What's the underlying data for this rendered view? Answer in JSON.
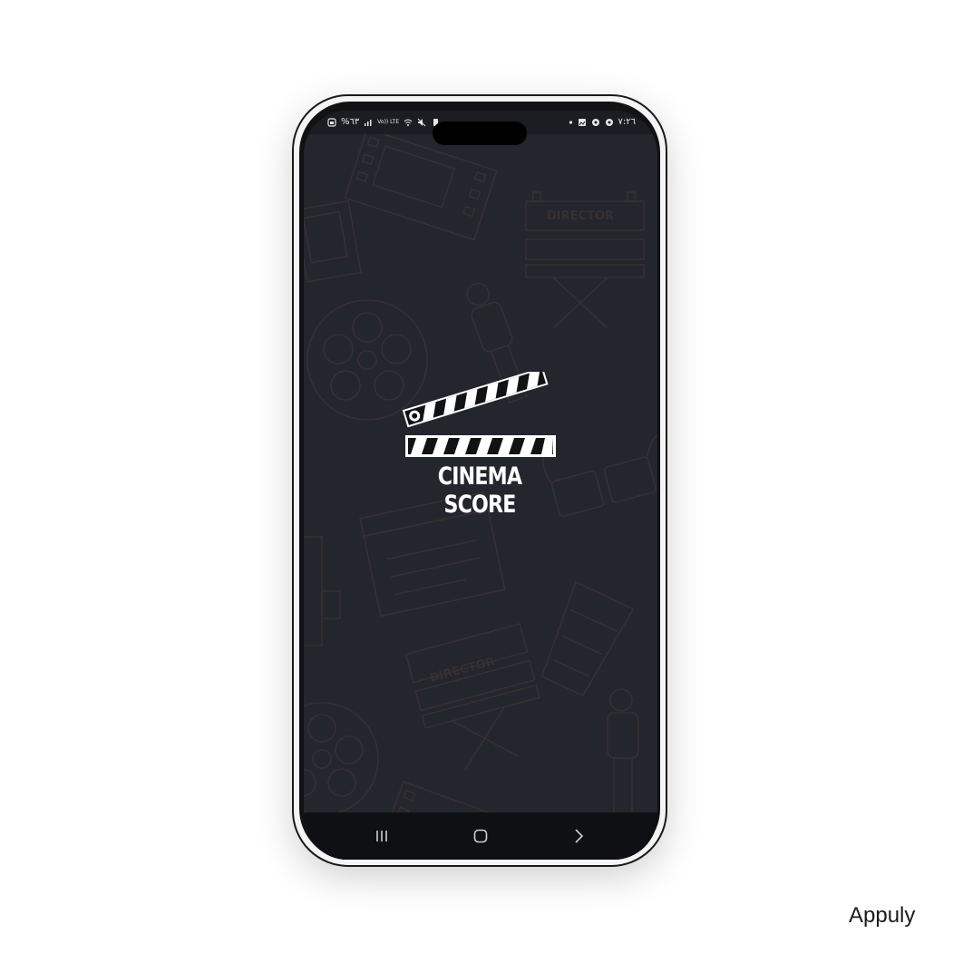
{
  "status_bar": {
    "battery_percent": "%٦٣",
    "network_label": "Vo)) LTE",
    "time": "٧:٢٦",
    "icons_left": [
      "battery-icon",
      "signal-icon",
      "volte-icon",
      "wifi-icon",
      "mute-icon",
      "battery-saver-icon"
    ],
    "icons_right": [
      "dot-icon",
      "gallery-icon",
      "globe-icon",
      "globe-icon"
    ]
  },
  "app": {
    "name": "CINEMA SCORE",
    "background_color": "#23262d",
    "art_labels": [
      "DIRECTOR",
      "DIRECTOR"
    ]
  },
  "nav_bar": {
    "buttons": [
      "recent-apps-icon",
      "home-icon",
      "back-icon"
    ]
  },
  "watermark": "Appuly"
}
